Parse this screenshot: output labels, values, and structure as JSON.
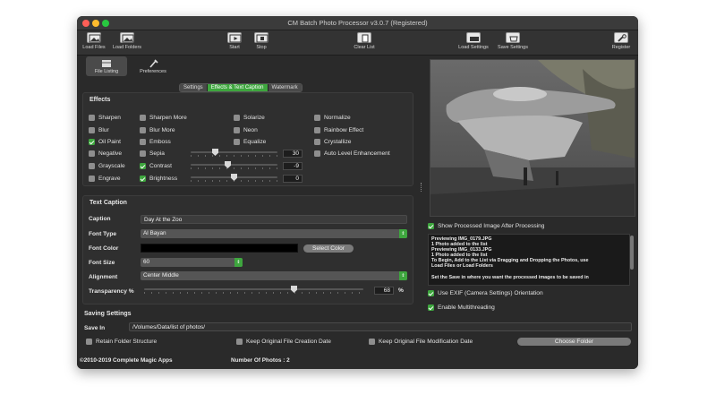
{
  "window": {
    "title": "CM Batch Photo Processor v3.0.7 (Registered)"
  },
  "toolbar": {
    "load_files": "Load Files",
    "load_folders": "Load Folders",
    "start": "Start",
    "stop": "Stop",
    "clear_list": "Clear List",
    "load_settings": "Load Settings",
    "save_settings": "Save Settings",
    "register": "Register"
  },
  "top_tabs": {
    "file_listing": "File Listing",
    "preferences": "Preferences"
  },
  "segments": [
    "Settings",
    "Effects & Text Caption",
    "Watermark"
  ],
  "effects": {
    "heading": "Effects",
    "items": [
      {
        "label": "Sharpen",
        "checked": false
      },
      {
        "label": "Blur",
        "checked": false
      },
      {
        "label": "Oil Paint",
        "checked": true
      },
      {
        "label": "Negative",
        "checked": false
      },
      {
        "label": "Grayscale",
        "checked": false
      },
      {
        "label": "Engrave",
        "checked": false
      },
      {
        "label": "Sharpen More",
        "checked": false
      },
      {
        "label": "Blur More",
        "checked": false
      },
      {
        "label": "Emboss",
        "checked": false
      },
      {
        "label": "Sepia",
        "checked": false
      },
      {
        "label": "Contrast",
        "checked": true
      },
      {
        "label": "Brightness",
        "checked": true
      },
      {
        "label": "Solarize",
        "checked": false
      },
      {
        "label": "Neon",
        "checked": false
      },
      {
        "label": "Equalize",
        "checked": false
      },
      {
        "label": "Normalize",
        "checked": false
      },
      {
        "label": "Rainbow Effect",
        "checked": false
      },
      {
        "label": "Crystallize",
        "checked": false
      },
      {
        "label": "Auto Level Enhancement",
        "checked": false
      }
    ],
    "sepia_value": "30",
    "contrast_value": "-9",
    "brightness_value": "0"
  },
  "caption": {
    "heading": "Text Caption",
    "caption_label": "Caption",
    "caption_value": "Day At the Zoo",
    "font_type_label": "Font Type",
    "font_type_value": "Al Bayan",
    "font_color_label": "Font Color",
    "font_color": "#000000",
    "select_color": "Select Color",
    "font_size_label": "Font Size",
    "font_size_value": "60",
    "alignment_label": "Alignment",
    "alignment_value": "Center Middle",
    "transparency_label": "Transparency %",
    "transparency_value": "68",
    "percent_sign": "%"
  },
  "saving": {
    "heading": "Saving Settings",
    "save_in_label": "Save In",
    "save_in_value": "/Volumes/Data/list of photos/",
    "retain": "Retain Folder Structure",
    "keep_creation": "Keep Original File Creation Date",
    "keep_modification": "Keep Original File Modification Date",
    "choose_folder": "Choose Folder"
  },
  "right": {
    "show_processed": "Show Processed Image After Processing",
    "log": [
      "Previewing IMG_0179.JPG",
      "1 Photo added to the list",
      "Previewing IMG_0133.JPG",
      "1 Photo added to the list",
      "To Begin, Add to the List via Dragging and Dropping the Photos, use",
      "Load Files or Load Folders",
      "",
      "Set the Save in where you want the processed images to be saved in"
    ],
    "use_exif": "Use EXIF (Camera Settings) Orientation",
    "multithreading": "Enable Multithreading"
  },
  "footer": {
    "copyright": "©2010-2019 Complete Magic Apps",
    "photo_count": "Number Of Photos : 2"
  },
  "colors": {
    "accent": "#3ea63e",
    "window_bg": "#2a2a2a",
    "red": "#fe5f57",
    "yellow": "#febc2e",
    "green": "#28c840"
  }
}
